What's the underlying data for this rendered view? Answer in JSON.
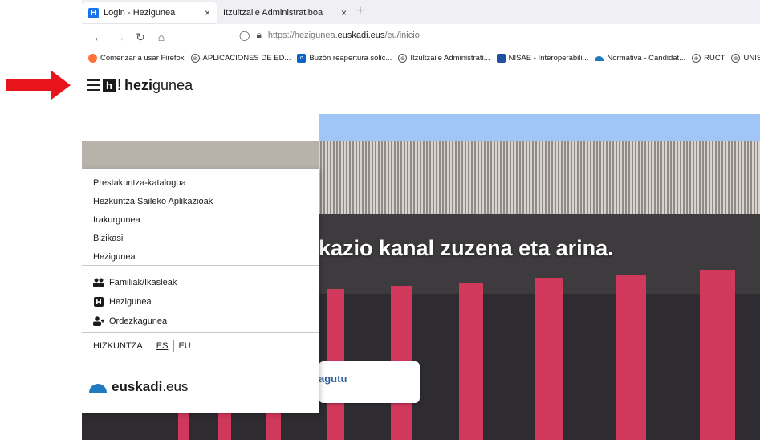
{
  "tabs": [
    {
      "title": "Login - Hezigunea",
      "icon": "hezigunea-favicon",
      "close": "×"
    },
    {
      "title": "Itzultzaile Administratiboa",
      "close": "×"
    }
  ],
  "new_tab_label": "+",
  "nav": {
    "url_prefix": "https://hezigunea.",
    "url_domain": "euskadi.eus",
    "url_path": "/eu/inicio"
  },
  "bookmarks": [
    {
      "label": "Comenzar a usar Firefox",
      "icon": "firefox-icon"
    },
    {
      "label": "APLICACIONES DE ED...",
      "icon": "globe-icon"
    },
    {
      "label": "Buzón reapertura solic...",
      "icon": "outlook-icon"
    },
    {
      "label": "Itzultzaile Administrati...",
      "icon": "globe-icon"
    },
    {
      "label": "NISAE - Interoperabili...",
      "icon": "nisae-icon"
    },
    {
      "label": "Normativa - Candidat...",
      "icon": "euskadi-icon"
    },
    {
      "label": "RUCT",
      "icon": "globe-icon"
    },
    {
      "label": "UNISYS",
      "icon": "globe-icon"
    }
  ],
  "site": {
    "logo_mark": "h",
    "logo_exclaim": "!",
    "logo_bold": "hezi",
    "logo_light": "gunea"
  },
  "hero": {
    "headline": "kazio kanal zuzena eta arina.",
    "button": "agutu"
  },
  "drawer": {
    "links": [
      "Prestakuntza-katalogoa",
      "Hezkuntza Saileko Aplikazioak",
      "Irakurgunea",
      "Bizikasi",
      "Hezigunea"
    ],
    "icon_links": [
      {
        "label": "Familiak/Ikasleak",
        "icon": "users-icon"
      },
      {
        "label": "Hezigunea",
        "icon": "hezigunea-icon"
      },
      {
        "label": "Ordezkagunea",
        "icon": "user-add-icon"
      }
    ],
    "language_label": "HIZKUNTZA:",
    "lang_es": "ES",
    "lang_eu": "EU",
    "footer_logo_bold": "euskadi",
    "footer_logo_light": ".eus"
  },
  "colors": {
    "arrow": "#e8141c",
    "blue_band": "#9fc6f7",
    "pillar": "#d0395c",
    "link_blue": "#2d5f9a"
  }
}
